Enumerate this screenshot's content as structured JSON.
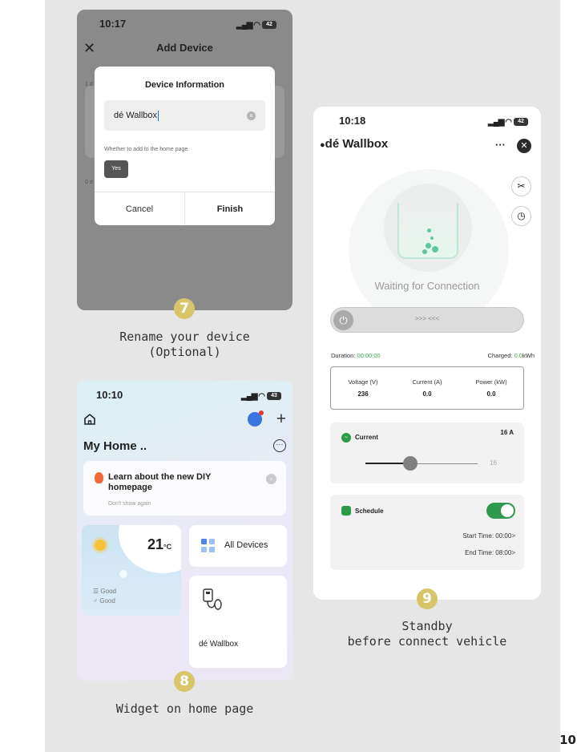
{
  "page_number": "10",
  "step7": {
    "badge": "7",
    "caption_line1": "Rename your device",
    "caption_line2": "(Optional)",
    "time": "10:17",
    "battery": "42",
    "screen_title": "Add Device",
    "bg_text_1": "1 d",
    "bg_text_2": "0 d",
    "dialog": {
      "title": "Device Information",
      "name_value": "dé Wallbox",
      "home_hint": "Whether to add to the home page",
      "yes_label": "Yes",
      "cancel_label": "Cancel",
      "finish_label": "Finish"
    }
  },
  "step8": {
    "badge": "8",
    "caption": "Widget on home page",
    "time": "10:10",
    "battery": "43",
    "home_title": "My Home ..",
    "learn_title": "Learn about the new DIY homepage",
    "learn_dismiss": "Don't show again",
    "temperature": "21",
    "temperature_unit": "°C",
    "air_quality_1": "Good",
    "air_quality_2": "Good",
    "all_devices": "All Devices",
    "device_name": "dé Wallbox"
  },
  "step9": {
    "badge": "9",
    "caption_line1": "Standby",
    "caption_line2": "before connect vehicle",
    "time": "10:18",
    "battery": "42",
    "device_title": "dé Wallbox",
    "more_label": "···",
    "status": "Waiting for Connection",
    "slider_hint": ">>> <<<",
    "duration_label": "Duration: ",
    "duration_value": "00:00:00",
    "charged_label": "Charged: ",
    "charged_value": "0.0",
    "charged_unit": "kWh",
    "metrics": [
      {
        "label": "Voltage (V)",
        "value": "236"
      },
      {
        "label": "Current (A)",
        "value": "0.0"
      },
      {
        "label": "Power (kW)",
        "value": "0.0"
      }
    ],
    "current_label": "Current",
    "current_setting": "16 A",
    "current_slider_value": "16",
    "current_slider_fraction": 0.4,
    "schedule_label": "Schedule",
    "schedule_enabled": true,
    "start_time": "Start Time: 00:00>",
    "end_time": "End Time: 08:00>"
  },
  "colors": {
    "badge": "#d8c56a",
    "accent_green": "#2f9a4d",
    "overlay_gray": "#8a8a8a"
  }
}
